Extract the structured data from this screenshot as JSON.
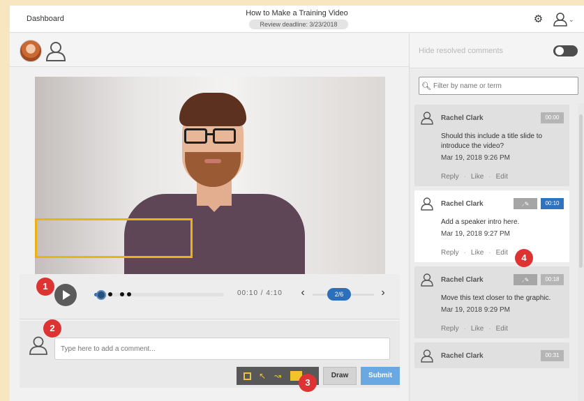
{
  "header": {
    "dashboard_label": "Dashboard",
    "title": "How to Make a Training Video",
    "deadline": "Review deadline: 3/23/2018",
    "settings_icon": "gear-icon",
    "user_icon": "user-icon"
  },
  "participants": [
    {
      "type": "photo",
      "name": "participant-photo"
    },
    {
      "type": "generic",
      "icon": "user-icon"
    }
  ],
  "player": {
    "timecode": "00:10 / 4:10",
    "progress": 0.054,
    "comment_markers": [
      0.11,
      0.2,
      0.25
    ],
    "comment_nav": "2/6"
  },
  "composer": {
    "placeholder": "Type here to add a comment...",
    "tools": [
      "rectangle-tool",
      "arrow-tool",
      "freehand-tool",
      "color-swatch"
    ],
    "draw_label": "Draw",
    "submit_label": "Submit"
  },
  "steps": [
    "1",
    "2",
    "3",
    "4"
  ],
  "panel": {
    "hide_resolved_label": "Hide resolved comments",
    "hide_resolved_on": true,
    "filter_placeholder": "Filter by name or term",
    "comments": [
      {
        "author": "Rachel Clark",
        "time": "00:00",
        "has_drawing": false,
        "active": false,
        "text": "Should this include a title slide to introduce the video?",
        "date": "Mar 19, 2018 9:26 PM"
      },
      {
        "author": "Rachel Clark",
        "time": "00:10",
        "has_drawing": true,
        "active": true,
        "text": "Add a speaker intro here.",
        "date": "Mar 19, 2018 9:27 PM"
      },
      {
        "author": "Rachel Clark",
        "time": "00:18",
        "has_drawing": true,
        "active": false,
        "text": "Move this text closer to the graphic.",
        "date": "Mar 19, 2018 9:29 PM"
      },
      {
        "author": "Rachel Clark",
        "time": "00:31",
        "has_drawing": false,
        "active": false
      }
    ],
    "actions": {
      "reply": "Reply",
      "like": "Like",
      "edit": "Edit",
      "sep": "·"
    }
  },
  "colors": {
    "accent": "#2e73c2",
    "annotation": "#e9b318",
    "badge": "#dd3333"
  }
}
